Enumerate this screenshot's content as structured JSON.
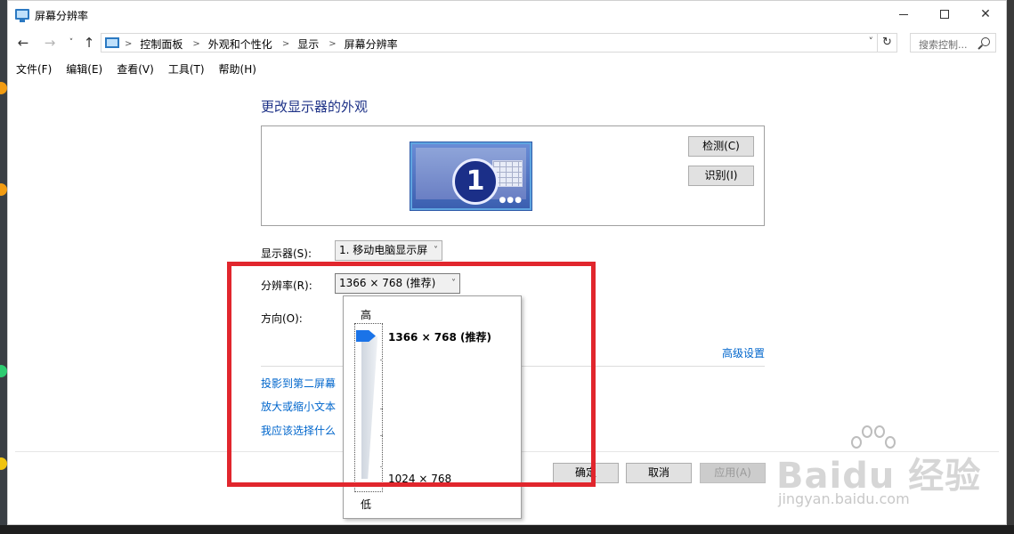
{
  "window": {
    "title": "屏幕分辨率",
    "controls": {
      "minimize": "—",
      "maximize": "☐",
      "close": "✕"
    }
  },
  "nav": {
    "back": "←",
    "forward": "→",
    "recent": "˅",
    "up": "↑",
    "breadcrumbs": [
      "控制面板",
      "外观和个性化",
      "显示",
      "屏幕分辨率"
    ],
    "separator": ">",
    "dropdown": "˅",
    "refresh": "↻",
    "search_placeholder": "搜索控制..."
  },
  "menubar": [
    "文件(F)",
    "编辑(E)",
    "查看(V)",
    "工具(T)",
    "帮助(H)"
  ],
  "main": {
    "heading": "更改显示器的外观",
    "monitor_number": "1",
    "detect_button": "检测(C)",
    "identify_button": "识别(I)",
    "display_label": "显示器(S):",
    "display_value": "1. 移动电脑显示屏",
    "resolution_label": "分辨率(R):",
    "resolution_value": "1366 × 768 (推荐)",
    "orientation_label": "方向(O):",
    "advanced_link": "高级设置",
    "links": [
      "投影到第二屏幕",
      "放大或缩小文本",
      "我应该选择什么"
    ],
    "ok_button": "确定",
    "cancel_button": "取消",
    "apply_button": "应用(A)"
  },
  "resolution_popup": {
    "high_label": "高",
    "low_label": "低",
    "options": [
      "1366 × 768 (推荐)",
      "1024 × 768"
    ],
    "selected_index": 0,
    "slider_position": 1.0
  },
  "watermark": {
    "text": "Baidu 经验",
    "url": "jingyan.baidu.com"
  },
  "colors": {
    "accent": "#1a73e8",
    "link": "#0066cc",
    "heading": "#1e3287",
    "highlight": "#e1262d"
  }
}
